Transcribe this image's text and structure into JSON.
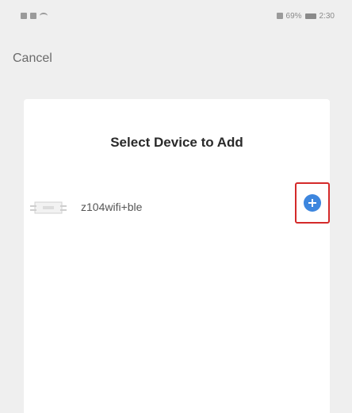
{
  "status_bar": {
    "left_text": "",
    "right_text": "69%",
    "time": "2:30"
  },
  "top_bar": {
    "cancel_label": "Cancel"
  },
  "card": {
    "title": "Select Device to Add",
    "devices": [
      {
        "name": "z104wifi+ble",
        "icon": "device-module-icon"
      }
    ],
    "add_icon": "plus-circle-icon",
    "accent_color": "#3d86de",
    "highlight_color": "#d42a2a"
  }
}
